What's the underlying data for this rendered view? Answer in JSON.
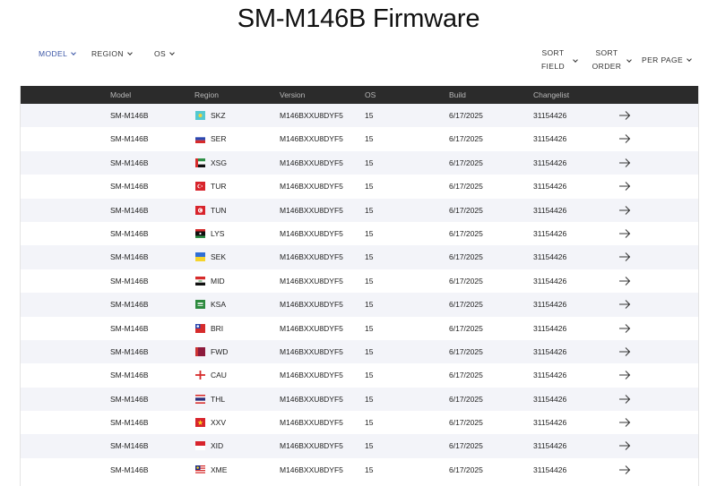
{
  "page": {
    "title": "SM-M146B Firmware"
  },
  "filters": {
    "model": "MODEL",
    "region": "REGION",
    "os": "OS",
    "sort_field_line1": "SORT",
    "sort_field_line2": "FIELD",
    "sort_order_line1": "SORT",
    "sort_order_line2": "ORDER",
    "per_page": "PER PAGE"
  },
  "table": {
    "headers": [
      "Model",
      "Region",
      "Version",
      "OS",
      "Build",
      "Changelist"
    ],
    "rows": [
      {
        "model": "SM-M146B",
        "region": "SKZ",
        "flag": "kazakhstan-flag-icon",
        "version": "M146BXXU8DYF5",
        "os": "15",
        "build": "6/17/2025",
        "changelist": "31154426"
      },
      {
        "model": "SM-M146B",
        "region": "SER",
        "flag": "russia-flag-icon",
        "version": "M146BXXU8DYF5",
        "os": "15",
        "build": "6/17/2025",
        "changelist": "31154426"
      },
      {
        "model": "SM-M146B",
        "region": "XSG",
        "flag": "uae-flag-icon",
        "version": "M146BXXU8DYF5",
        "os": "15",
        "build": "6/17/2025",
        "changelist": "31154426"
      },
      {
        "model": "SM-M146B",
        "region": "TUR",
        "flag": "turkey-flag-icon",
        "version": "M146BXXU8DYF5",
        "os": "15",
        "build": "6/17/2025",
        "changelist": "31154426"
      },
      {
        "model": "SM-M146B",
        "region": "TUN",
        "flag": "tunisia-flag-icon",
        "version": "M146BXXU8DYF5",
        "os": "15",
        "build": "6/17/2025",
        "changelist": "31154426"
      },
      {
        "model": "SM-M146B",
        "region": "LYS",
        "flag": "libya-flag-icon",
        "version": "M146BXXU8DYF5",
        "os": "15",
        "build": "6/17/2025",
        "changelist": "31154426"
      },
      {
        "model": "SM-M146B",
        "region": "SEK",
        "flag": "ukraine-flag-icon",
        "version": "M146BXXU8DYF5",
        "os": "15",
        "build": "6/17/2025",
        "changelist": "31154426"
      },
      {
        "model": "SM-M146B",
        "region": "MID",
        "flag": "iraq-flag-icon",
        "version": "M146BXXU8DYF5",
        "os": "15",
        "build": "6/17/2025",
        "changelist": "31154426"
      },
      {
        "model": "SM-M146B",
        "region": "KSA",
        "flag": "saudi-arabia-flag-icon",
        "version": "M146BXXU8DYF5",
        "os": "15",
        "build": "6/17/2025",
        "changelist": "31154426"
      },
      {
        "model": "SM-M146B",
        "region": "BRI",
        "flag": "taiwan-flag-icon",
        "version": "M146BXXU8DYF5",
        "os": "15",
        "build": "6/17/2025",
        "changelist": "31154426"
      },
      {
        "model": "SM-M146B",
        "region": "FWD",
        "flag": "qatar-flag-icon",
        "version": "M146BXXU8DYF5",
        "os": "15",
        "build": "6/17/2025",
        "changelist": "31154426"
      },
      {
        "model": "SM-M146B",
        "region": "CAU",
        "flag": "georgia-flag-icon",
        "version": "M146BXXU8DYF5",
        "os": "15",
        "build": "6/17/2025",
        "changelist": "31154426"
      },
      {
        "model": "SM-M146B",
        "region": "THL",
        "flag": "thailand-flag-icon",
        "version": "M146BXXU8DYF5",
        "os": "15",
        "build": "6/17/2025",
        "changelist": "31154426"
      },
      {
        "model": "SM-M146B",
        "region": "XXV",
        "flag": "vietnam-flag-icon",
        "version": "M146BXXU8DYF5",
        "os": "15",
        "build": "6/17/2025",
        "changelist": "31154426"
      },
      {
        "model": "SM-M146B",
        "region": "XID",
        "flag": "indonesia-flag-icon",
        "version": "M146BXXU8DYF5",
        "os": "15",
        "build": "6/17/2025",
        "changelist": "31154426"
      },
      {
        "model": "SM-M146B",
        "region": "XME",
        "flag": "malaysia-flag-icon",
        "version": "M146BXXU8DYF5",
        "os": "15",
        "build": "6/17/2025",
        "changelist": "31154426"
      }
    ]
  },
  "colors": {
    "accent": "#3a55a6",
    "header_bg": "#2b2b2b",
    "stripe": "#f3f4f9"
  }
}
